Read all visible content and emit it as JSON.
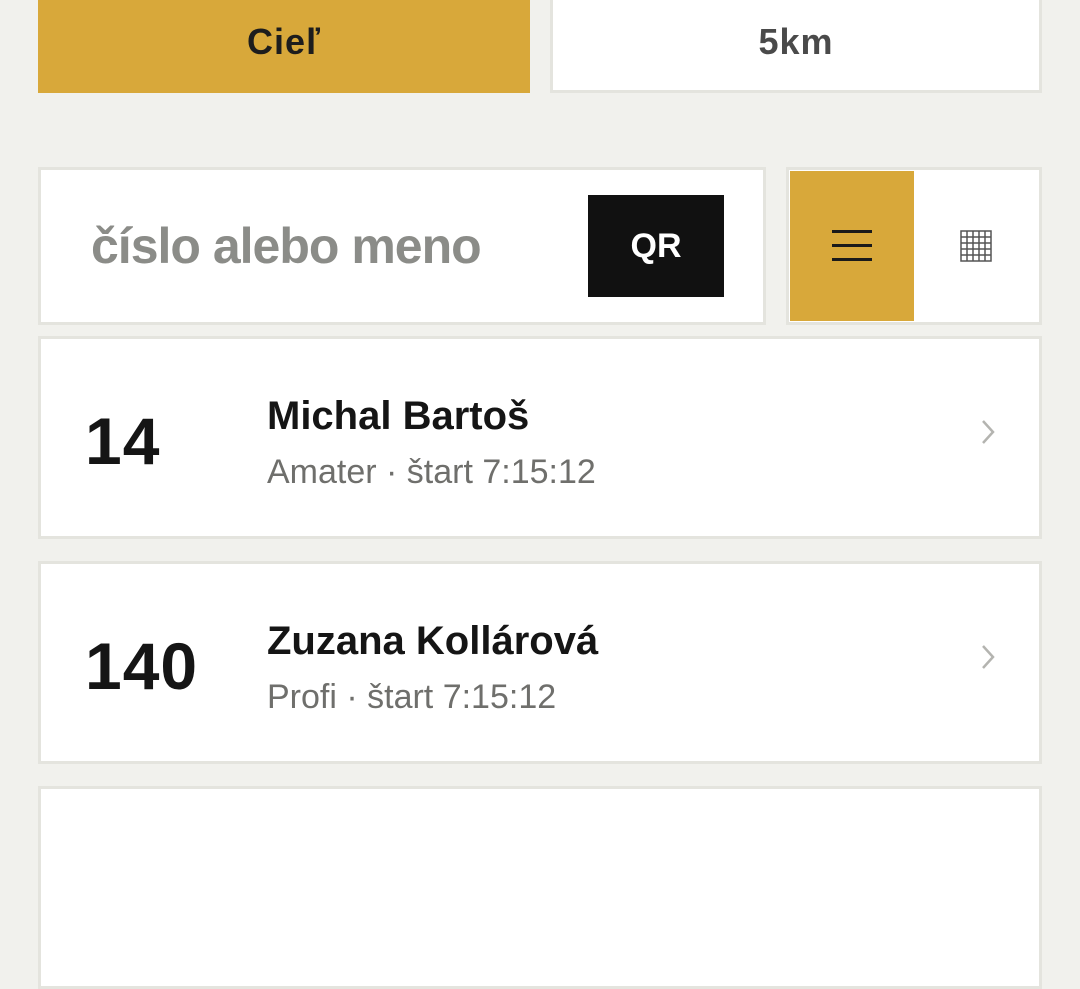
{
  "tabs": {
    "finish_label": "Cieľ",
    "distance_label": "5km"
  },
  "search": {
    "placeholder": "číslo alebo meno",
    "value": "",
    "qr_label": "QR"
  },
  "view_toggle": {
    "active": "list",
    "list_icon": "hamburger-list-icon",
    "grid_icon": "grid-icon"
  },
  "colors": {
    "accent": "#d8a83a",
    "background": "#f1f1ed",
    "qr_button": "#111111"
  },
  "runners": [
    {
      "bib": "14",
      "name": "Michal Bartoš",
      "meta": "Amater · štart 7:15:12"
    },
    {
      "bib": "140",
      "name": "Zuzana Kollárová",
      "meta": "Profi · štart 7:15:12"
    }
  ]
}
